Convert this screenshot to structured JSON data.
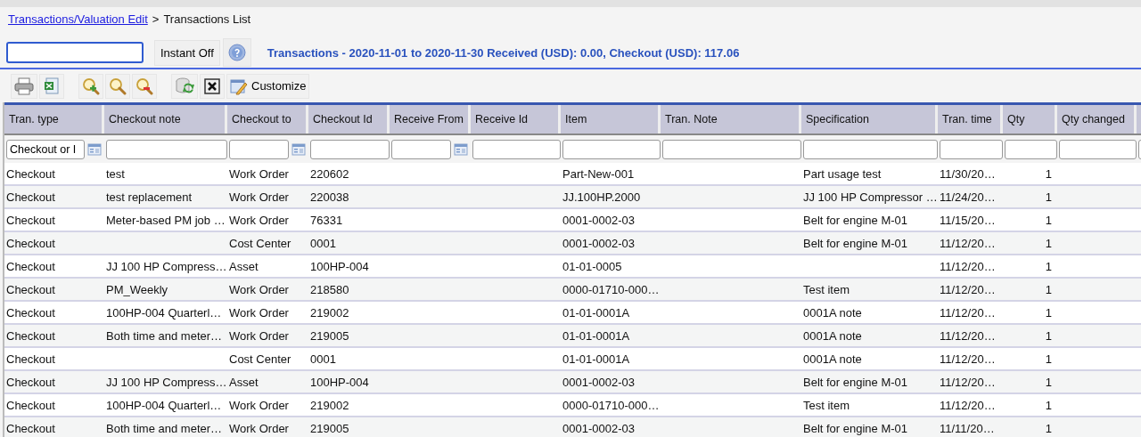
{
  "breadcrumb": {
    "link": "Transactions/Valuation Edit",
    "separator": ">",
    "current": "Transactions List"
  },
  "search": {
    "instant_button": "Instant Off"
  },
  "summary": "Transactions - 2020-11-01 to 2020-11-30 Received (USD): 0.00, Checkout (USD): 117.06",
  "toolbar": {
    "customize_label": "Customize"
  },
  "table": {
    "columns": [
      {
        "label": "Tran. type",
        "kind": "text",
        "picker": true,
        "filter_value": "Checkout or I"
      },
      {
        "label": "Checkout note",
        "kind": "text",
        "picker": false
      },
      {
        "label": "Checkout to",
        "kind": "text",
        "picker": true
      },
      {
        "label": "Checkout Id",
        "kind": "text",
        "picker": false
      },
      {
        "label": "Receive From",
        "kind": "text",
        "picker": true
      },
      {
        "label": "Receive Id",
        "kind": "text",
        "picker": false
      },
      {
        "label": "Item",
        "kind": "text",
        "picker": false
      },
      {
        "label": "Tran. Note",
        "kind": "text",
        "picker": false
      },
      {
        "label": "Specification",
        "kind": "text",
        "picker": false
      },
      {
        "label": "Tran. time",
        "kind": "text",
        "picker": false
      },
      {
        "label": "Qty",
        "kind": "number",
        "picker": false
      },
      {
        "label": "Qty changed",
        "kind": "text",
        "picker": false
      }
    ],
    "rows": [
      [
        "Checkout",
        "test",
        "Work Order",
        "220602",
        null,
        null,
        "Part-New-001",
        null,
        "Part usage test",
        "11/30/20…",
        "1",
        null
      ],
      [
        "Checkout",
        "test replacement",
        "Work Order",
        "220038",
        null,
        null,
        "JJ.100HP.2000",
        null,
        "JJ 100 HP Compressor …",
        "11/24/20…",
        "1",
        null
      ],
      [
        "Checkout",
        "Meter-based PM job …",
        "Work Order",
        "76331",
        null,
        null,
        "0001-0002-03",
        null,
        "Belt for engine M-01",
        "11/15/20…",
        "1",
        null
      ],
      [
        "Checkout",
        null,
        "Cost Center",
        "0001",
        null,
        null,
        "0001-0002-03",
        null,
        "Belt for engine M-01",
        "11/12/20…",
        "1",
        null
      ],
      [
        "Checkout",
        "JJ 100 HP Compress…",
        "Asset",
        "100HP-004",
        null,
        null,
        "01-01-0005",
        null,
        null,
        "11/12/20…",
        "1",
        null
      ],
      [
        "Checkout",
        "PM_Weekly",
        "Work Order",
        "218580",
        null,
        null,
        "0000-01710-000…",
        null,
        "Test item",
        "11/12/20…",
        "1",
        null
      ],
      [
        "Checkout",
        "100HP-004 Quarterl…",
        "Work Order",
        "219002",
        null,
        null,
        "01-01-0001A",
        null,
        "0001A note",
        "11/12/20…",
        "1",
        null
      ],
      [
        "Checkout",
        "Both time and meter…",
        "Work Order",
        "219005",
        null,
        null,
        "01-01-0001A",
        null,
        "0001A note",
        "11/12/20…",
        "1",
        null
      ],
      [
        "Checkout",
        null,
        "Cost Center",
        "0001",
        null,
        null,
        "01-01-0001A",
        null,
        "0001A note",
        "11/12/20…",
        "1",
        null
      ],
      [
        "Checkout",
        "JJ 100 HP Compress…",
        "Asset",
        "100HP-004",
        null,
        null,
        "0001-0002-03",
        null,
        "Belt for engine M-01",
        "11/12/20…",
        "1",
        null
      ],
      [
        "Checkout",
        "100HP-004 Quarterl…",
        "Work Order",
        "219002",
        null,
        null,
        "0000-01710-000…",
        null,
        "Test item",
        "11/12/20…",
        "1",
        null
      ],
      [
        "Checkout",
        "Both time and meter…",
        "Work Order",
        "219005",
        null,
        null,
        "0001-0002-03",
        null,
        "Belt for engine M-01",
        "11/11/20…",
        "1",
        null
      ]
    ]
  }
}
